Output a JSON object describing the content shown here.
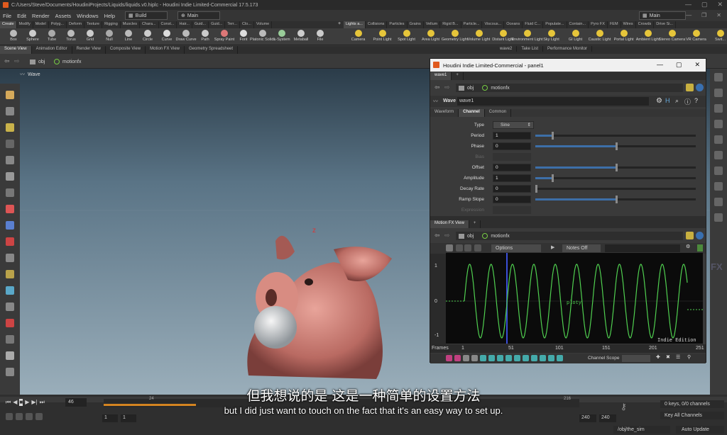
{
  "window": {
    "title": "C:/Users/Steve/Documents/HoudiniProjects/Liquids/liquids.v0.hiplc - Houdini Indie Limited-Commercial 17.5.173"
  },
  "menu": {
    "items": [
      "File",
      "Edit",
      "Render",
      "Assets",
      "Windows",
      "Help"
    ],
    "desktop": "Build",
    "layout": "Main",
    "right_desktop": "Main"
  },
  "shelf_tabs_left": [
    "Create",
    "Modify",
    "Model",
    "Polyg...",
    "Deform",
    "Texture",
    "Rigging",
    "Muscles",
    "Chara...",
    "Const...",
    "Hair...",
    "Guid...",
    "Guid...",
    "Terr...",
    "Clo...",
    "Volume"
  ],
  "shelf_tabs_right": [
    "Lights a...",
    "Collisions",
    "Particles",
    "Grains",
    "Vellum",
    "Rigid B...",
    "Particle...",
    "Viscous...",
    "Oceans",
    "Fluid C...",
    "Populate...",
    "Contain...",
    "Pyro FX",
    "FEM",
    "Wires",
    "Crowds",
    "Drive Si..."
  ],
  "shelf_tools_left": [
    "Box",
    "Sphere",
    "Tube",
    "Torus",
    "Grid",
    "Null",
    "Line",
    "Circle",
    "Curve",
    "Draw Curve",
    "Path",
    "Spray Paint",
    "Font",
    "Platonic Solids",
    "L-System",
    "Metaball",
    "File"
  ],
  "shelf_tools_right": [
    "Camera",
    "Point Light",
    "Spot Light",
    "Area Light",
    "Geometry Light",
    "Volume Light",
    "Distant Light",
    "Environment Light",
    "Sky Light",
    "GI Light",
    "Caustic Light",
    "Portal Light",
    "Ambient Light",
    "Stereo Camera",
    "VR Camera",
    "Swit..."
  ],
  "pane_tabs": [
    "Scene View",
    "Animation Editor",
    "Render View",
    "Composite View",
    "Motion FX View",
    "Geometry Spreadsheet"
  ],
  "pane_tabs_right": [
    "wave2",
    "Take List",
    "Performance Monitor"
  ],
  "path": {
    "obj": "obj",
    "node": "motionfx"
  },
  "viewport": {
    "title": "Wave"
  },
  "panel": {
    "title": "Houdini Indie Limited-Commercial - panel1",
    "tab": "wave1",
    "path_obj": "obj",
    "path_node": "motionfx",
    "node_type": "Wave",
    "node_name": "wave1",
    "tabs": [
      "Waveform",
      "Channel",
      "Common"
    ],
    "type_label": "Type",
    "type_value": "Sine",
    "parms": [
      {
        "label": "Period",
        "value": "1",
        "fill": 0.1
      },
      {
        "label": "Phase",
        "value": "0",
        "fill": 0.5
      },
      {
        "label": "Bias",
        "value": "",
        "fill": 0
      },
      {
        "label": "Offset",
        "value": "0",
        "fill": 0.5
      },
      {
        "label": "Amplitude",
        "value": "1",
        "fill": 0.1
      },
      {
        "label": "Decay Rate",
        "value": "0",
        "fill": 0
      },
      {
        "label": "Ramp Slope",
        "value": "0",
        "fill": 0.5
      },
      {
        "label": "Expression",
        "value": "",
        "fill": 0
      }
    ],
    "mfx_tab": "Motion FX View",
    "mfx_obj": "obj",
    "mfx_node": "motionfx",
    "options": "Options",
    "notes": "Notes Off",
    "y_labels": [
      "1",
      "0",
      "-1"
    ],
    "frames_label": "Frames",
    "x_labels": [
      "1",
      "51",
      "101",
      "151",
      "201",
      "251"
    ],
    "curve_label": "ploty",
    "edition": "Indie Edition",
    "channel_scope": "Channel Scope"
  },
  "timeline": {
    "frame": "46",
    "start": "1",
    "start2": "1",
    "end": "240",
    "end2": "240",
    "marks": [
      "24",
      "216"
    ],
    "keys": "0 keys, 0/0 channels",
    "key_all": "Key All Channels",
    "sim_path": "/obj/the_sim",
    "auto_update": "Auto Update"
  },
  "subtitles": {
    "cn": "但我想说的是 这是一种简单的设置方法",
    "en": "but I did just want to touch on the fact that it's an easy way to set up."
  },
  "fx_logo": "FX"
}
